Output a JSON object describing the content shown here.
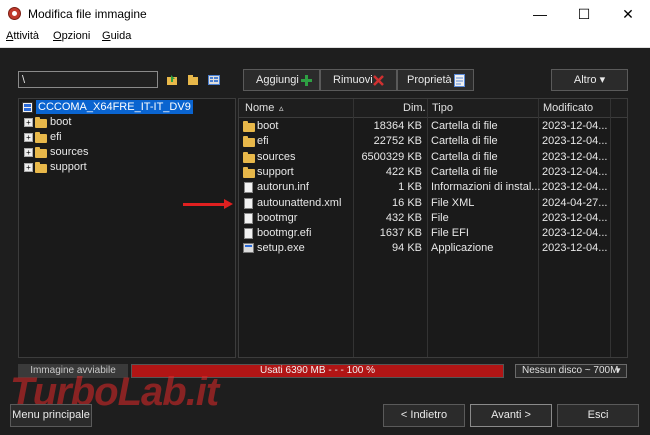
{
  "window": {
    "title": "Modifica file immagine",
    "minimize": "—",
    "maximize": "☐",
    "close": "✕"
  },
  "menu": [
    "Attività",
    "Opzioni",
    "Guida"
  ],
  "toolbar": {
    "path_value": "\\",
    "add_label": "Aggiungi",
    "remove_label": "Rimuovi",
    "properties_label": "Proprietà",
    "other_label": "Altro ▾"
  },
  "tree": {
    "root": "CCCOMA_X64FRE_IT-IT_DV9",
    "items": [
      "boot",
      "efi",
      "sources",
      "support"
    ]
  },
  "filelist": {
    "columns": [
      "Nome",
      "Dim.",
      "Tipo",
      "Modificato"
    ],
    "sort_indicator": "▵",
    "rows": [
      {
        "name": "boot",
        "size": "18364 KB",
        "type": "Cartella di file",
        "modified": "2023-12-04...",
        "icon": "folder-icon"
      },
      {
        "name": "efi",
        "size": "22752 KB",
        "type": "Cartella di file",
        "modified": "2023-12-04...",
        "icon": "folder-icon"
      },
      {
        "name": "sources",
        "size": "6500329 KB",
        "type": "Cartella di file",
        "modified": "2023-12-04...",
        "icon": "folder-icon"
      },
      {
        "name": "support",
        "size": "422 KB",
        "type": "Cartella di file",
        "modified": "2023-12-04...",
        "icon": "folder-icon"
      },
      {
        "name": "autorun.inf",
        "size": "1 KB",
        "type": "Informazioni di instal...",
        "modified": "2023-12-04...",
        "icon": "file-icon"
      },
      {
        "name": "autounattend.xml",
        "size": "16 KB",
        "type": "File XML",
        "modified": "2024-04-27...",
        "icon": "file-icon"
      },
      {
        "name": "bootmgr",
        "size": "432 KB",
        "type": "File",
        "modified": "2023-12-04...",
        "icon": "file-icon"
      },
      {
        "name": "bootmgr.efi",
        "size": "1637 KB",
        "type": "File EFI",
        "modified": "2023-12-04...",
        "icon": "file-icon"
      },
      {
        "name": "setup.exe",
        "size": "94 KB",
        "type": "Applicazione",
        "modified": "2023-12-04...",
        "icon": "exe-icon"
      }
    ]
  },
  "status": {
    "image_label": "Immagine avviabile",
    "usage_text": "Usati  6390 MB  - - -  100 %",
    "usage_fraction": 1.0,
    "disk_option": "Nessun disco ~ 700M"
  },
  "footer": {
    "main_menu": "Menu principale",
    "back": "< Indietro",
    "next": "Avanti >",
    "exit": "Esci"
  },
  "watermark": "TurboLab.it",
  "colors": {
    "accent_selection": "#0a64d0",
    "progress_fill": "#b11515",
    "annotation_arrow": "#e02020",
    "folder": "#e8b84a"
  }
}
